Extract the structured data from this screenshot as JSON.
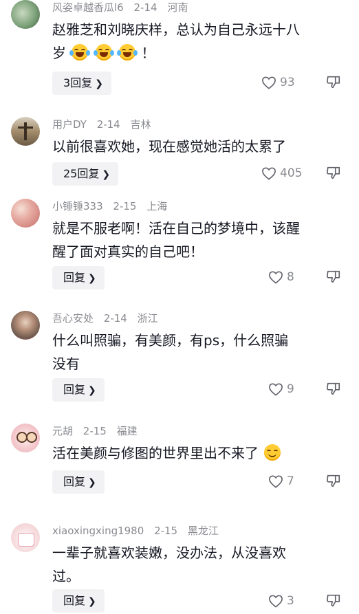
{
  "comments": [
    {
      "username": "风姿卓越香瓜l6",
      "date": "2-14",
      "location": "河南",
      "text_line1": "赵雅芝和刘晓庆样，总认为自己永远十八",
      "text_line2_prefix": "岁",
      "text_line2_suffix": "！",
      "emoji": "laughing-crying-emoji",
      "reply_label": "3回复",
      "likes": "93",
      "avatar_color": "#7da27a"
    },
    {
      "username": "用户DY",
      "date": "2-14",
      "location": "吉林",
      "text_line1": "以前很喜欢她，现在感觉她活的太累了",
      "reply_label": "25回复",
      "likes": "405",
      "avatar_color": "#a38c6b"
    },
    {
      "username": "小锤锤333",
      "date": "2-15",
      "location": "上海",
      "text_line1": "就是不服老啊！活在自己的梦境中，该醒",
      "text_line2": "醒了面对真实的自己吧！",
      "reply_label": "回复",
      "likes": "8",
      "avatar_color": "#d9a7a0"
    },
    {
      "username": "吾心安处",
      "date": "2-14",
      "location": "浙江",
      "text_line1": "什么叫照骗，有美颜，有ps，什么照骗",
      "text_line2": "没有",
      "reply_label": "回复",
      "likes": "9",
      "avatar_color": "#6e5a4e"
    },
    {
      "username": "元胡",
      "date": "2-15",
      "location": "福建",
      "text_line1": "活在美颜与修图的世界里出不来了",
      "emoji": "smile-emoji",
      "reply_label": "回复",
      "likes": "7",
      "avatar_color": "#e8b0b8"
    },
    {
      "username": "xiaoxingxing1980",
      "date": "2-15",
      "location": "黑龙江",
      "text_line1": "一辈子就喜欢装嫩，没办法，从没喜欢",
      "text_line2": "过。",
      "reply_label": "回复",
      "likes": "3",
      "avatar_color": "#f1c6c9"
    }
  ],
  "icons": {
    "like": "heart-outline-icon",
    "dislike": "thumbs-down-icon",
    "chevron": "chevron-right-icon"
  },
  "colors": {
    "meta_text": "#8a8b91",
    "reply_bg": "#f2f2f4"
  }
}
